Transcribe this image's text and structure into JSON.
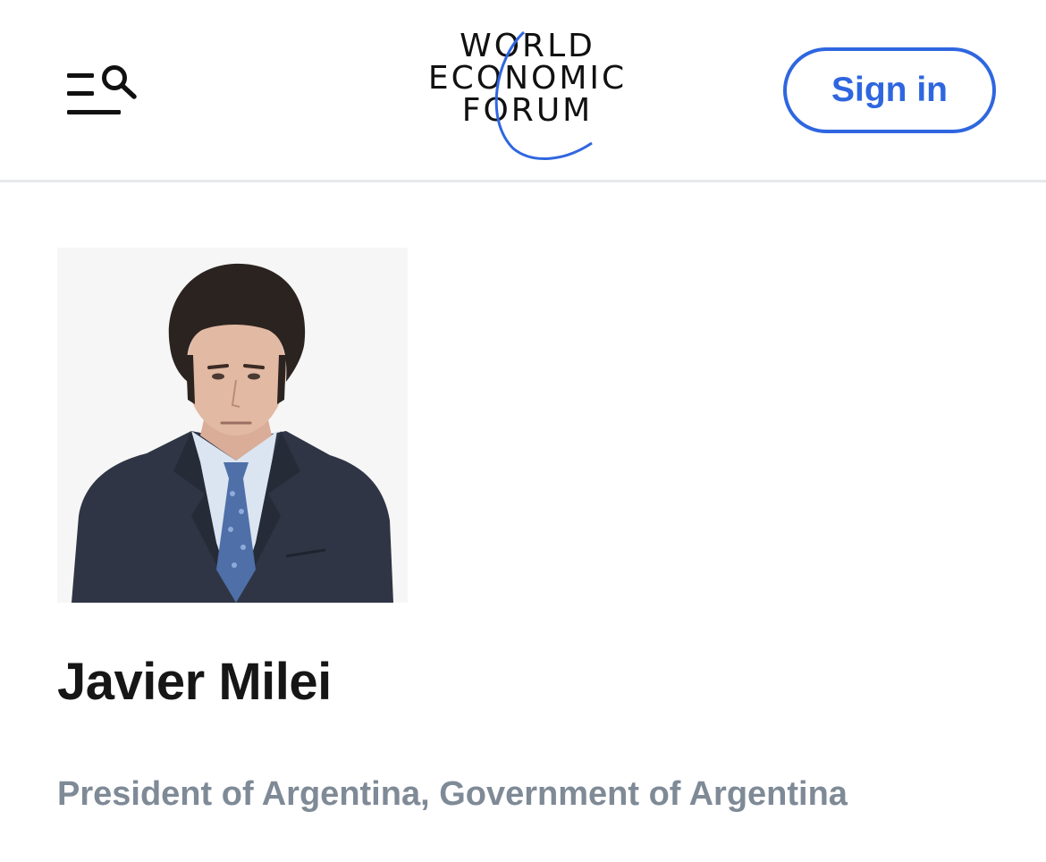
{
  "header": {
    "menu_icon": "menu-icon",
    "search_icon": "search-icon",
    "logo": {
      "line1": "WORLD",
      "line2": "ECONOMIC",
      "line3": "FORUM"
    },
    "sign_in_label": "Sign in"
  },
  "profile": {
    "photo_icon": "person-portrait",
    "name": "Javier Milei",
    "position": "President of Argentina, Government of Argentina"
  },
  "colors": {
    "accent": "#2f66e0",
    "text": "#161616",
    "muted": "#7f8a97",
    "divider": "#e6e8eb"
  }
}
